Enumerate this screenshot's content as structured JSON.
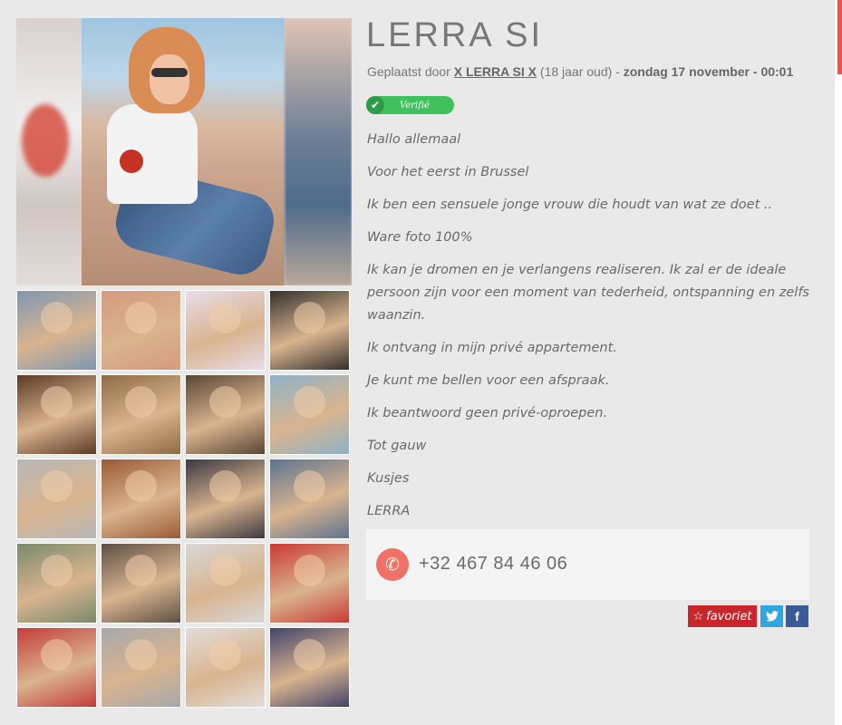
{
  "profile": {
    "title": "LERRA SI",
    "posted_prefix": "Geplaatst door",
    "author": "X LERRA SI X",
    "age": "(18 jaar oud)",
    "separator": "-",
    "date": "zondag 17 november - 00:01",
    "verified_label": "Verifié"
  },
  "description": [
    "Hallo allemaal",
    "Voor het eerst in Brussel",
    "Ik ben een sensuele jonge vrouw die houdt van wat ze doet ..",
    "Ware foto 100%",
    "Ik kan je dromen en je verlangens realiseren. Ik zal er de ideale persoon zijn voor een moment van tederheid, ontspanning en zelfs waanzin.",
    "Ik ontvang in mijn privé appartement.",
    "Je kunt me bellen voor een afspraak.",
    "Ik beantwoord geen privé-oproepen.",
    "Tot gauw",
    "Kusjes",
    "LERRA"
  ],
  "contact": {
    "phone": "+32 467 84 46 06",
    "icon": "phone-icon"
  },
  "actions": {
    "favorite_label": "favoriet",
    "favorite_icon": "star-icon",
    "twitter_icon": "twitter-icon",
    "facebook_icon": "facebook-icon"
  },
  "gallery": {
    "main_photo": "woman-sitting-on-rocks-photo",
    "thumbnails": [
      {
        "label": "photo-thumbnail",
        "tone": "#7e98b2"
      },
      {
        "label": "photo-thumbnail",
        "tone": "#d69a7e"
      },
      {
        "label": "photo-thumbnail",
        "tone": "#e9dceb"
      },
      {
        "label": "photo-thumbnail",
        "tone": "#34302c"
      },
      {
        "label": "photo-thumbnail",
        "tone": "#5b3a24"
      },
      {
        "label": "photo-thumbnail",
        "tone": "#8e6a45"
      },
      {
        "label": "photo-thumbnail",
        "tone": "#5a4634"
      },
      {
        "label": "photo-thumbnail",
        "tone": "#8fb3c6"
      },
      {
        "label": "photo-thumbnail",
        "tone": "#b8b8b8"
      },
      {
        "label": "photo-thumbnail",
        "tone": "#9a5a34"
      },
      {
        "label": "photo-thumbnail",
        "tone": "#3c3a42"
      },
      {
        "label": "photo-thumbnail",
        "tone": "#5d7390"
      },
      {
        "label": "photo-thumbnail",
        "tone": "#7a8a6c"
      },
      {
        "label": "photo-thumbnail",
        "tone": "#5e5046"
      },
      {
        "label": "photo-thumbnail",
        "tone": "#d8d8d8"
      },
      {
        "label": "photo-thumbnail",
        "tone": "#c93a34"
      },
      {
        "label": "photo-thumbnail",
        "tone": "#c43c3a"
      },
      {
        "label": "photo-thumbnail",
        "tone": "#a7a9ab"
      },
      {
        "label": "photo-thumbnail",
        "tone": "#e2ddd8"
      },
      {
        "label": "photo-thumbnail",
        "tone": "#42446a"
      }
    ]
  },
  "colors": {
    "background": "#e9e9e9",
    "verified_green": "#3fc25c",
    "phone_accent": "#f07266",
    "favorite_red": "#c9262c",
    "twitter_blue": "#2ea7e0",
    "facebook_blue": "#3a5b9a"
  }
}
